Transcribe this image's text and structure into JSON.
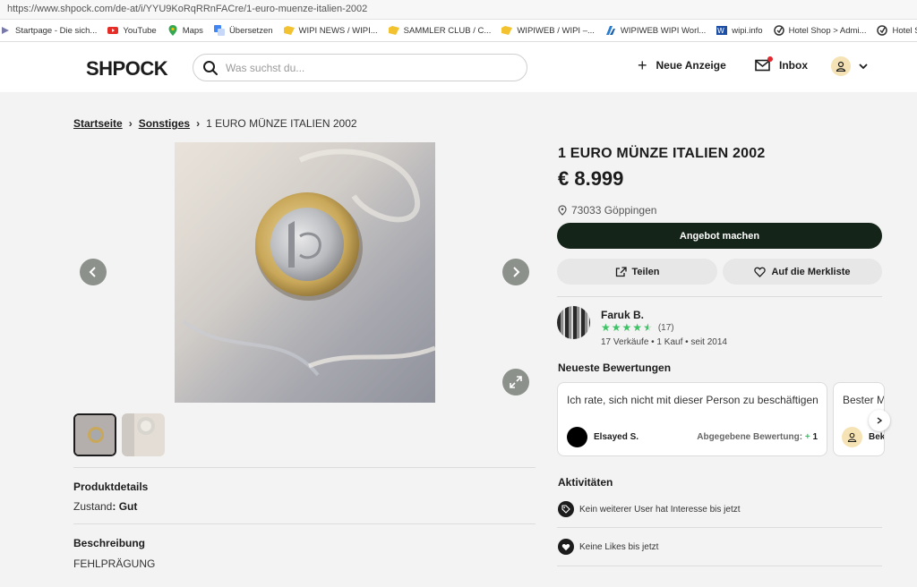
{
  "browser": {
    "url": "https://www.shpock.com/de-at/i/YYU9KoRqRRnFACre/1-euro-muenze-italien-2002",
    "bookmarks": [
      {
        "label": "Startpage - Die sich...",
        "icon": "startpage-icon"
      },
      {
        "label": "YouTube",
        "icon": "youtube-icon"
      },
      {
        "label": "Maps",
        "icon": "maps-pin-icon"
      },
      {
        "label": "Übersetzen",
        "icon": "translate-icon"
      },
      {
        "label": "WIPI NEWS / WIPI...",
        "icon": "folder-icon"
      },
      {
        "label": "SAMMLER CLUB / C...",
        "icon": "folder-icon"
      },
      {
        "label": "WIPIWEB / WIPI –...",
        "icon": "folder-icon"
      },
      {
        "label": "WIPIWEB WIPI Worl...",
        "icon": "globe-icon"
      },
      {
        "label": "wipi.info",
        "icon": "wipi-icon"
      },
      {
        "label": "Hotel Shop > Admi...",
        "icon": "target-icon"
      },
      {
        "label": "Hotel Shop",
        "icon": "target-icon"
      }
    ]
  },
  "header": {
    "logo": "SHPOCK",
    "search_placeholder": "Was suchst du...",
    "new_ad_label": "Neue Anzeige",
    "inbox_label": "Inbox"
  },
  "breadcrumb": {
    "home": "Startseite",
    "category": "Sonstiges",
    "current": "1 EURO MÜNZE ITALIEN 2002"
  },
  "listing": {
    "title": "1 EURO MÜNZE ITALIEN 2002",
    "price": "€ 8.999",
    "location": "73033 Göppingen",
    "offer_button": "Angebot machen",
    "share_button": "Teilen",
    "watch_button": "Auf die Merkliste"
  },
  "details": {
    "section_title": "Produktdetails",
    "condition_label": "Zustand",
    "condition_value": ": Gut",
    "description_title": "Beschreibung",
    "description": "FEHLPRÄGUNG"
  },
  "seller": {
    "name": "Faruk B.",
    "rating_stars": 4.5,
    "rating_count": "(17)",
    "meta": "17 Verkäufe • 1 Kauf • seit 2014"
  },
  "reviews": {
    "title": "Neueste Bewertungen",
    "items": [
      {
        "text": "Ich rate, sich nicht mit dieser Person zu beschäftigen",
        "reviewer": "Elsayed S.",
        "given_label": "Abgegebene Bewertung:",
        "given_sign": "+",
        "given_value": "1"
      },
      {
        "text": "Bester Ma",
        "reviewer": "Bek"
      }
    ]
  },
  "activities": {
    "title": "Aktivitäten",
    "items": [
      {
        "text": "Kein weiterer User hat Interesse bis jetzt",
        "icon": "tag-icon"
      },
      {
        "text": "Keine Likes bis jetzt",
        "icon": "heart-icon"
      }
    ]
  },
  "colors": {
    "primary_dark": "#152419",
    "star_green": "#3ec266",
    "page_bg": "#f3f3f3"
  }
}
